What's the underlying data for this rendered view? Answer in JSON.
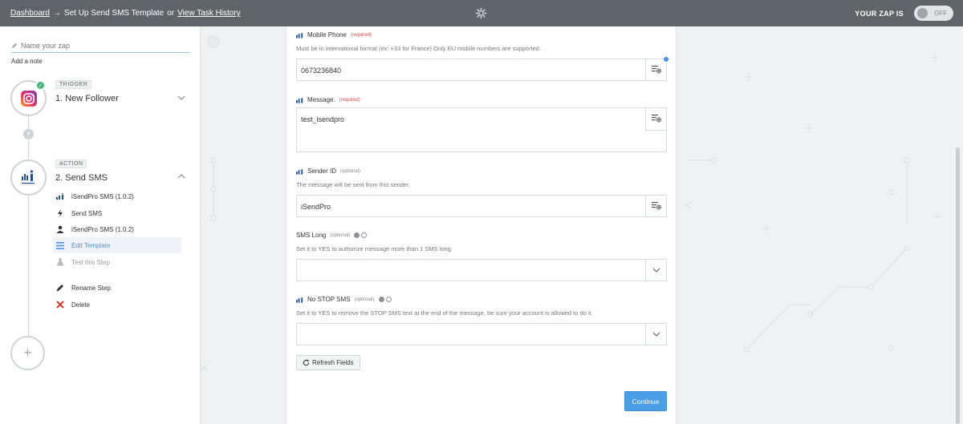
{
  "topbar": {
    "dashboard": "Dashboard",
    "arrow": "→",
    "current": "Set Up Send SMS Template",
    "or": "or",
    "history": "View Task History",
    "zap_status_label": "YOUR ZAP IS",
    "toggle_label": "OFF"
  },
  "sidebar": {
    "zapname_placeholder": "Name your zap",
    "add_note": "Add a note",
    "trigger": {
      "tag": "TRIGGER",
      "title": "1. New Follower"
    },
    "action": {
      "tag": "ACTION",
      "title": "2. Send SMS"
    },
    "menu": [
      {
        "label": "iSendPro SMS (1.0.2)",
        "icon": "app-icon"
      },
      {
        "label": "Send SMS",
        "icon": "bolt-icon"
      },
      {
        "label": "iSendPro SMS (1.0.2)",
        "icon": "user-icon"
      },
      {
        "label": "Edit Template",
        "icon": "list-icon"
      },
      {
        "label": "Test this Step",
        "icon": "flask-icon"
      },
      {
        "label": "Rename Step",
        "icon": "pencil-icon"
      },
      {
        "label": "Delete",
        "icon": "close-icon"
      }
    ],
    "plus_small": "+",
    "plus_big": "+"
  },
  "form": {
    "mobile": {
      "label": "Mobile Phone",
      "tag": "(required)",
      "help": "Must be in international format (ex: +33 for France) Only EU mobile numbers are supported.",
      "value": "0673236840"
    },
    "message": {
      "label": "Message.",
      "tag": "(required)",
      "value": "test_isendpro"
    },
    "sender": {
      "label": "Sender ID",
      "tag": "(optional)",
      "help": "The message will be sent from this sender.",
      "value": "iSendPro"
    },
    "smslong": {
      "label": "SMS Long",
      "tag": "(optional)",
      "help": "Set it to YES to authorize message more than 1 SMS long.",
      "value": ""
    },
    "nostop": {
      "label": "No STOP SMS",
      "tag": "(optional)",
      "help": "Set it to YES to remove the STOP SMS text at the end of the message, be sure your account is allowed to do it.",
      "value": ""
    },
    "refresh": "Refresh Fields",
    "continue": "Continue"
  },
  "colors": {
    "topbar": "#5f6469",
    "accent": "#4a90e2",
    "success": "#3fb77b",
    "required": "#e24b4b"
  }
}
